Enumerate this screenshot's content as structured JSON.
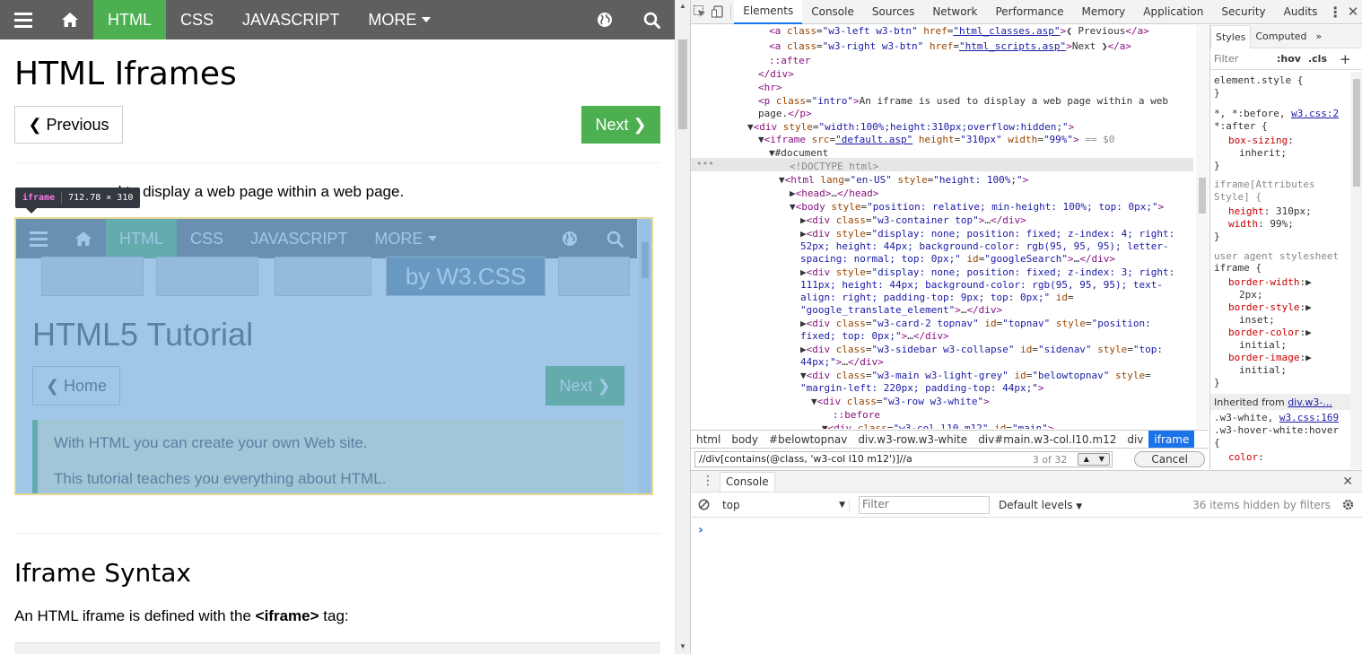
{
  "page": {
    "nav": {
      "items": [
        "HTML",
        "CSS",
        "JAVASCRIPT",
        "MORE"
      ],
      "active": "HTML",
      "icons": [
        "menu-icon",
        "home-icon",
        "globe-icon",
        "search-icon"
      ]
    },
    "title": "HTML Iframes",
    "prev_label": "❮ Previous",
    "next_label": "Next ❯",
    "intro_visible": "d to display a web page within a web page.",
    "tooltip": {
      "tag": "iframe",
      "size": "712.78 × 310"
    },
    "iframe_preview": {
      "nav_items": [
        "HTML",
        "CSS",
        "JAVASCRIPT",
        "MORE"
      ],
      "banner_text": "by W3.CSS",
      "title": "HTML5 Tutorial",
      "home_label": "❮ Home",
      "next_label": "Next ❯",
      "note_lines": [
        "With HTML you can create your own Web site.",
        "This tutorial teaches you everything about HTML."
      ]
    },
    "h2": "Iframe Syntax",
    "para_before": "An HTML iframe is defined with the ",
    "para_tag": "<iframe>",
    "para_after": " tag:"
  },
  "devtools": {
    "tabs": [
      "Elements",
      "Console",
      "Sources",
      "Network",
      "Performance",
      "Memory",
      "Application",
      "Security",
      "Audits"
    ],
    "active_tab": "Elements",
    "breadcrumbs": [
      "html",
      "body",
      "#belowtopnav",
      "div.w3-row.w3-white",
      "div#main.w3-col.l10.m12",
      "div",
      "iframe"
    ],
    "active_crumb": "iframe",
    "search_query": "//div[contains(@class, 'w3-col l10 m12')]//a",
    "search_count": "3 of 32",
    "cancel_label": "Cancel",
    "styles": {
      "tabs": [
        "Styles",
        "Computed"
      ],
      "filter_placeholder": "Filter",
      "hov": ":hov",
      "cls": ".cls",
      "inherited_from_label": "Inherited from",
      "inherited_from_value": "div.w3-..."
    },
    "console": {
      "tab_label": "Console",
      "context": "top",
      "filter_placeholder": "Filter",
      "levels": "Default levels",
      "hidden_count": "36 items hidden by filters"
    }
  }
}
